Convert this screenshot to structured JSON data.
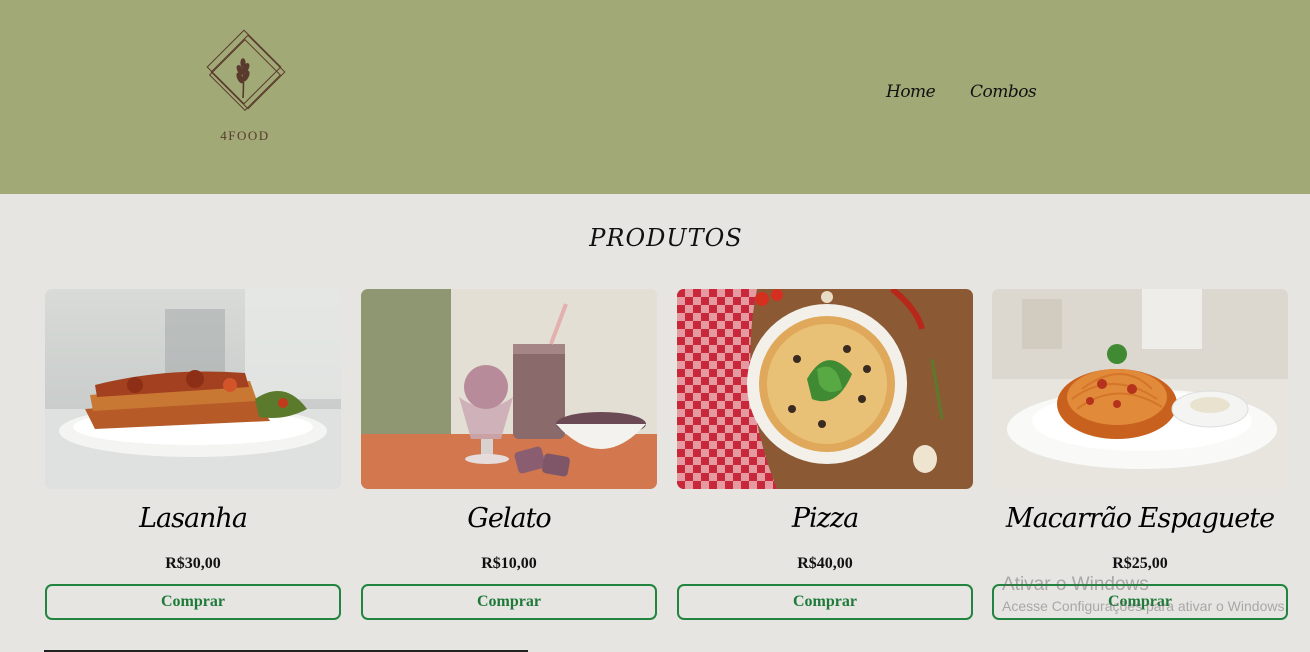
{
  "brand": {
    "name": "4FOOD",
    "logo_icon": "wheat-sprig-diamond-icon"
  },
  "nav": {
    "items": [
      {
        "label": "Home"
      },
      {
        "label": "Combos"
      }
    ]
  },
  "section": {
    "title": "PRODUTOS"
  },
  "products": [
    {
      "name": "Lasanha",
      "price": "R$30,00",
      "button": "Comprar",
      "image": "lasagna-plate"
    },
    {
      "name": "Gelato",
      "price": "R$10,00",
      "button": "Comprar",
      "image": "ice-cream-desserts"
    },
    {
      "name": "Pizza",
      "price": "R$40,00",
      "button": "Comprar",
      "image": "pizza-on-table"
    },
    {
      "name": "Macarrão Espaguete",
      "price": "R$25,00",
      "button": "Comprar",
      "image": "spaghetti-plate"
    }
  ],
  "watermark": {
    "title": "Ativar o Windows",
    "subtitle": "Acesse Configurações para ativar o Windows."
  },
  "colors": {
    "header_bg": "#a1a977",
    "page_bg": "#e7e5e2",
    "button_border": "#22853f",
    "logo_brown": "#5a3a2c"
  }
}
